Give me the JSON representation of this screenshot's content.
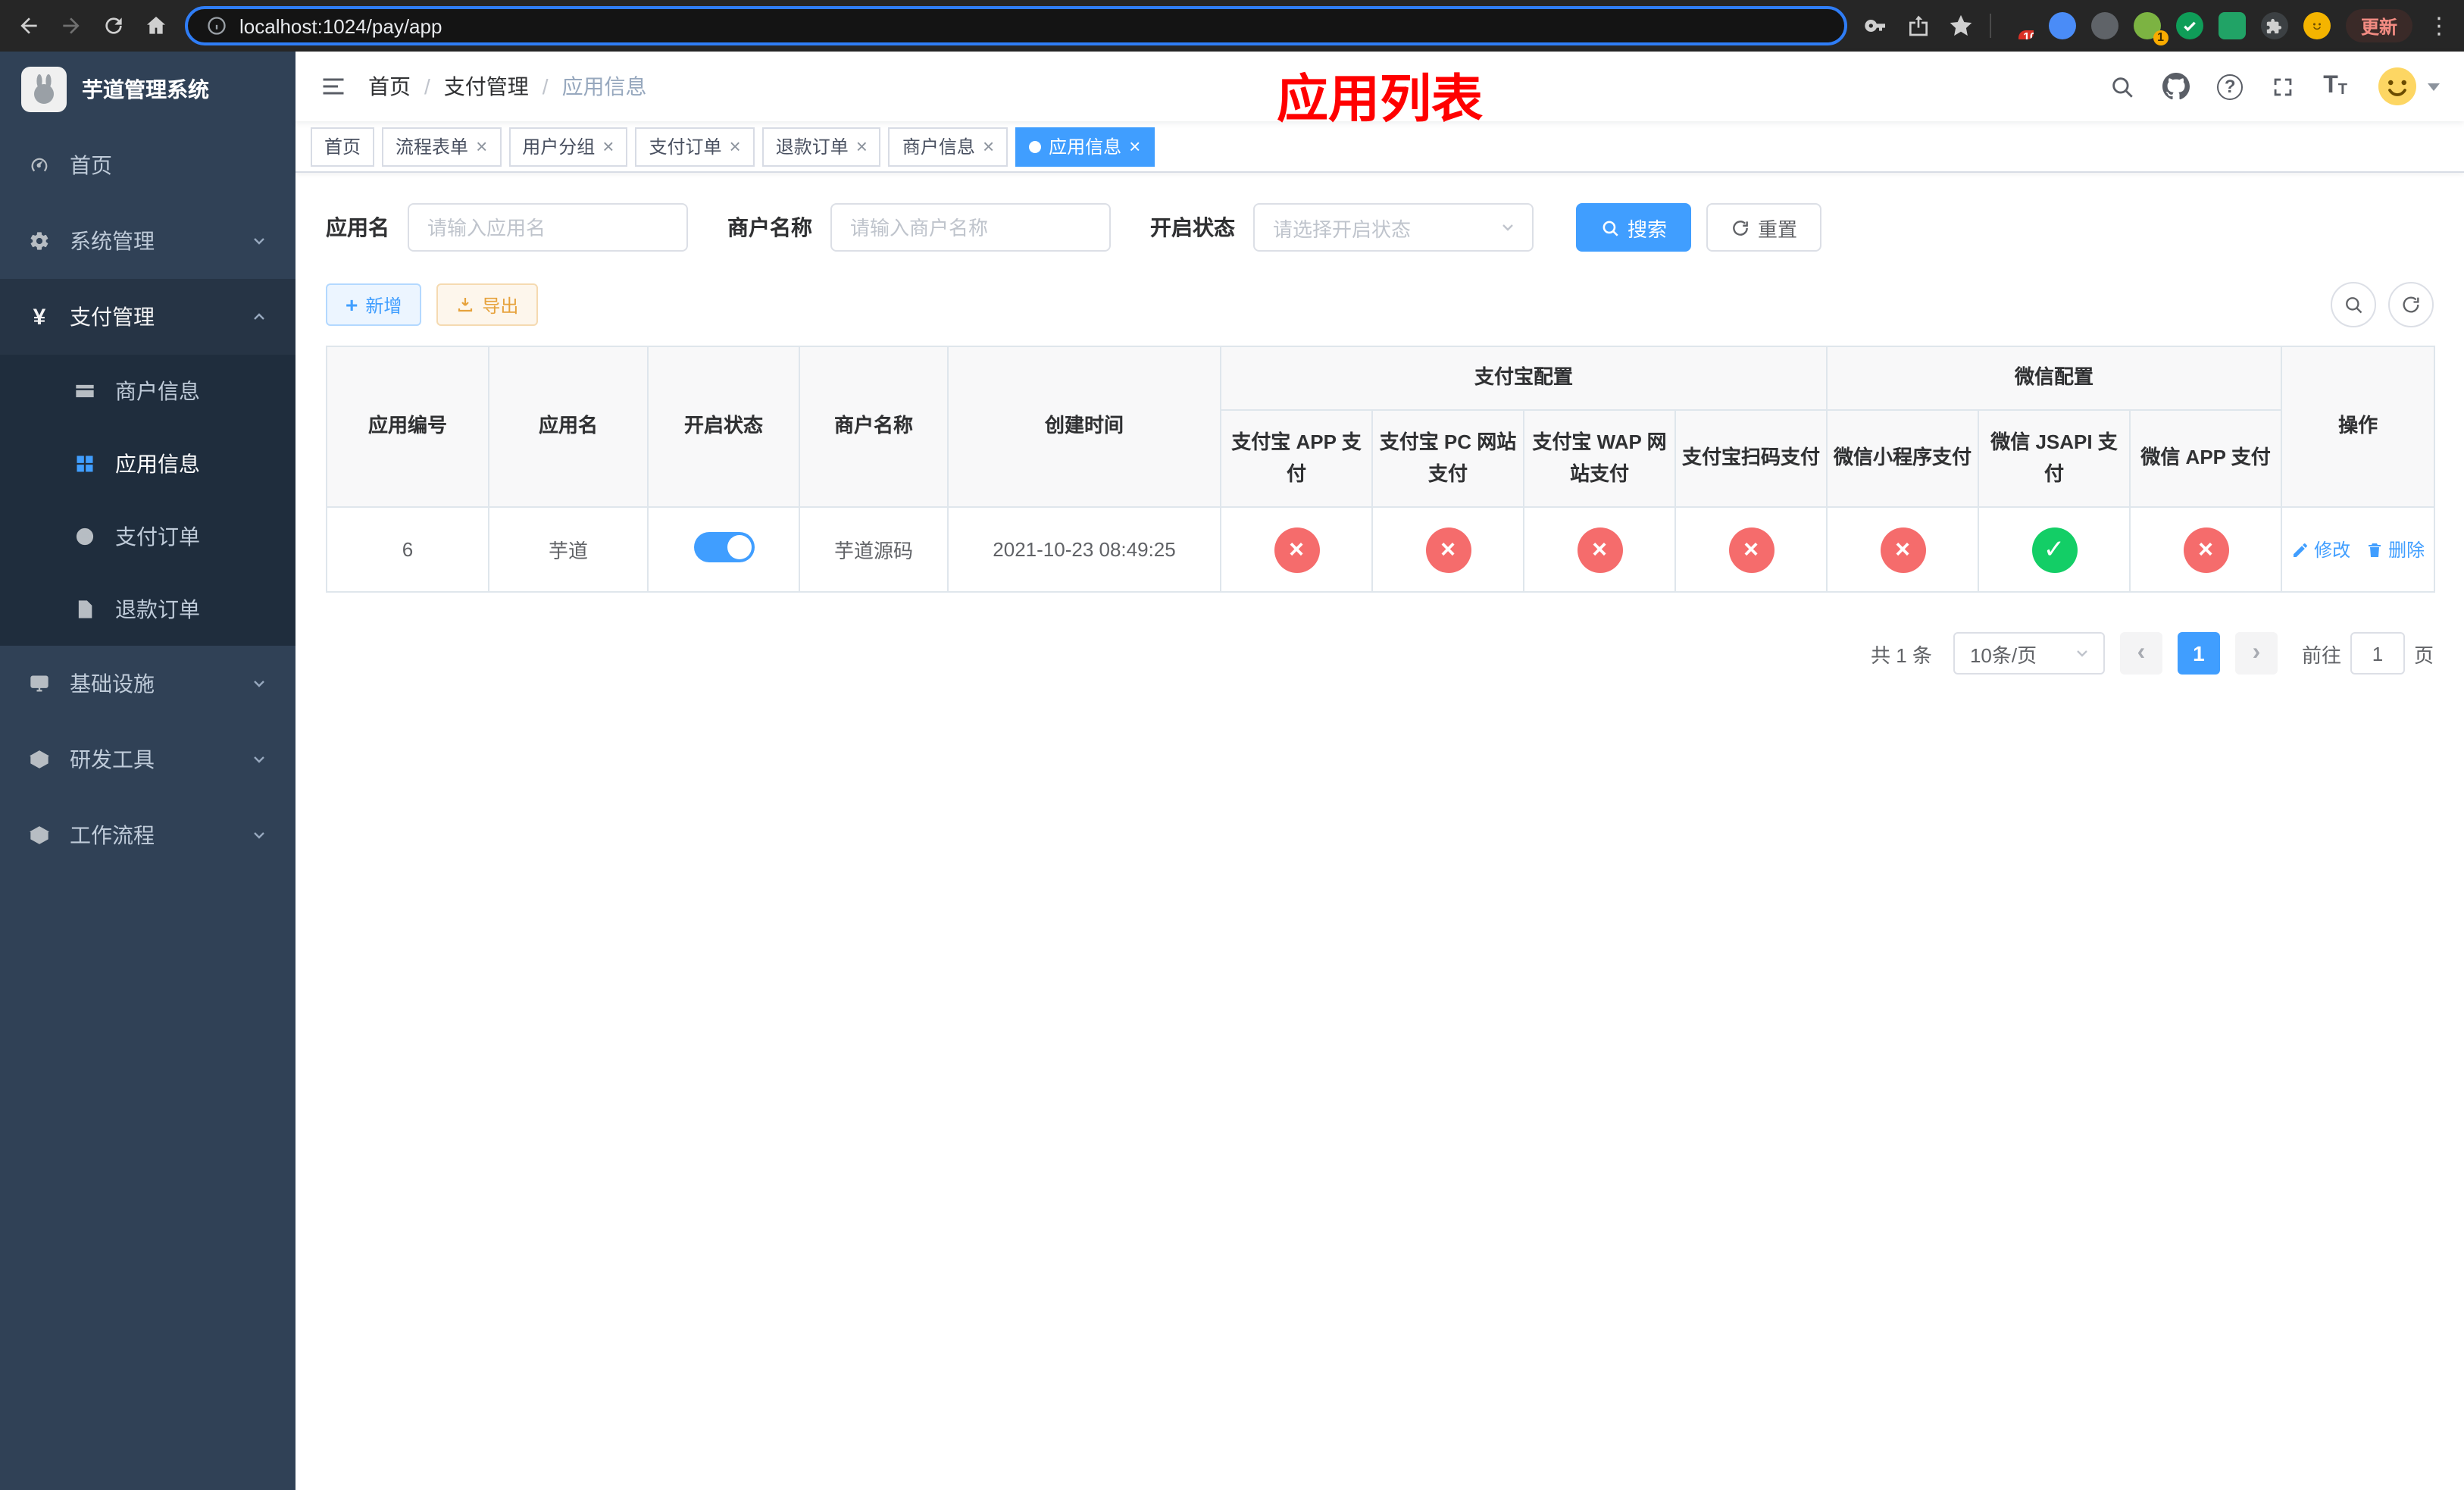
{
  "browser": {
    "url": "localhost:1024/pay/app",
    "update_label": "更新",
    "ext_badge_grid": "10",
    "ext_badge_avatar": "1"
  },
  "colors": {
    "accent": "#409eff",
    "danger": "#f56c6c",
    "success": "#13ce66",
    "warning": "#e6a23c",
    "sidebar_bg": "#304156"
  },
  "icons": {
    "close": "×",
    "check": "✓",
    "plus": "+",
    "yen": "¥",
    "question": "?",
    "font_big": "T",
    "font_small": "T",
    "chevron_left": "‹",
    "chevron_right": "›",
    "kebab": "⋮"
  },
  "sidebar": {
    "title": "芋道管理系统",
    "home": "首页",
    "system": "系统管理",
    "payment": "支付管理",
    "payment_children": [
      "商户信息",
      "应用信息",
      "支付订单",
      "退款订单"
    ],
    "infra": "基础设施",
    "devtools": "研发工具",
    "workflow": "工作流程"
  },
  "header": {
    "breadcrumb": [
      "首页",
      "支付管理",
      "应用信息"
    ],
    "separator": "/"
  },
  "annotation": {
    "title": "应用列表"
  },
  "tabs": [
    {
      "label": "首页"
    },
    {
      "label": "流程表单"
    },
    {
      "label": "用户分组"
    },
    {
      "label": "支付订单"
    },
    {
      "label": "退款订单"
    },
    {
      "label": "商户信息"
    },
    {
      "label": "应用信息"
    }
  ],
  "filters": {
    "app_name_label": "应用名",
    "app_name_placeholder": "请输入应用名",
    "merchant_label": "商户名称",
    "merchant_placeholder": "请输入商户名称",
    "status_label": "开启状态",
    "status_placeholder": "请选择开启状态",
    "search_button": "搜索",
    "reset_button": "重置"
  },
  "toolbar": {
    "add_button": "新增",
    "export_button": "导出"
  },
  "table": {
    "header": {
      "app_id": "应用编号",
      "app_name": "应用名",
      "status": "开启状态",
      "merchant": "商户名称",
      "created": "创建时间",
      "alipay_group": "支付宝配置",
      "wechat_group": "微信配置",
      "alipay_app": "支付宝 APP 支付",
      "alipay_pc": "支付宝 PC 网站支付",
      "alipay_wap": "支付宝 WAP 网站支付",
      "alipay_qr": "支付宝扫码支付",
      "wx_lite": "微信小程序支付",
      "wx_jsapi": "微信 JSAPI 支付",
      "wx_app": "微信 APP 支付",
      "actions": "操作"
    },
    "rows": [
      {
        "app_id": "6",
        "app_name": "芋道",
        "enabled": true,
        "merchant": "芋道源码",
        "created": "2021-10-23 08:49:25",
        "alipay_app": false,
        "alipay_pc": false,
        "alipay_wap": false,
        "alipay_qr": false,
        "wx_lite": false,
        "wx_jsapi": true,
        "wx_app": false,
        "edit_label": "修改",
        "delete_label": "删除"
      }
    ]
  },
  "pagination": {
    "total": "共 1 条",
    "page_size": "10条/页",
    "page": "1",
    "goto_prefix": "前往",
    "goto_value": "1",
    "goto_suffix": "页"
  }
}
